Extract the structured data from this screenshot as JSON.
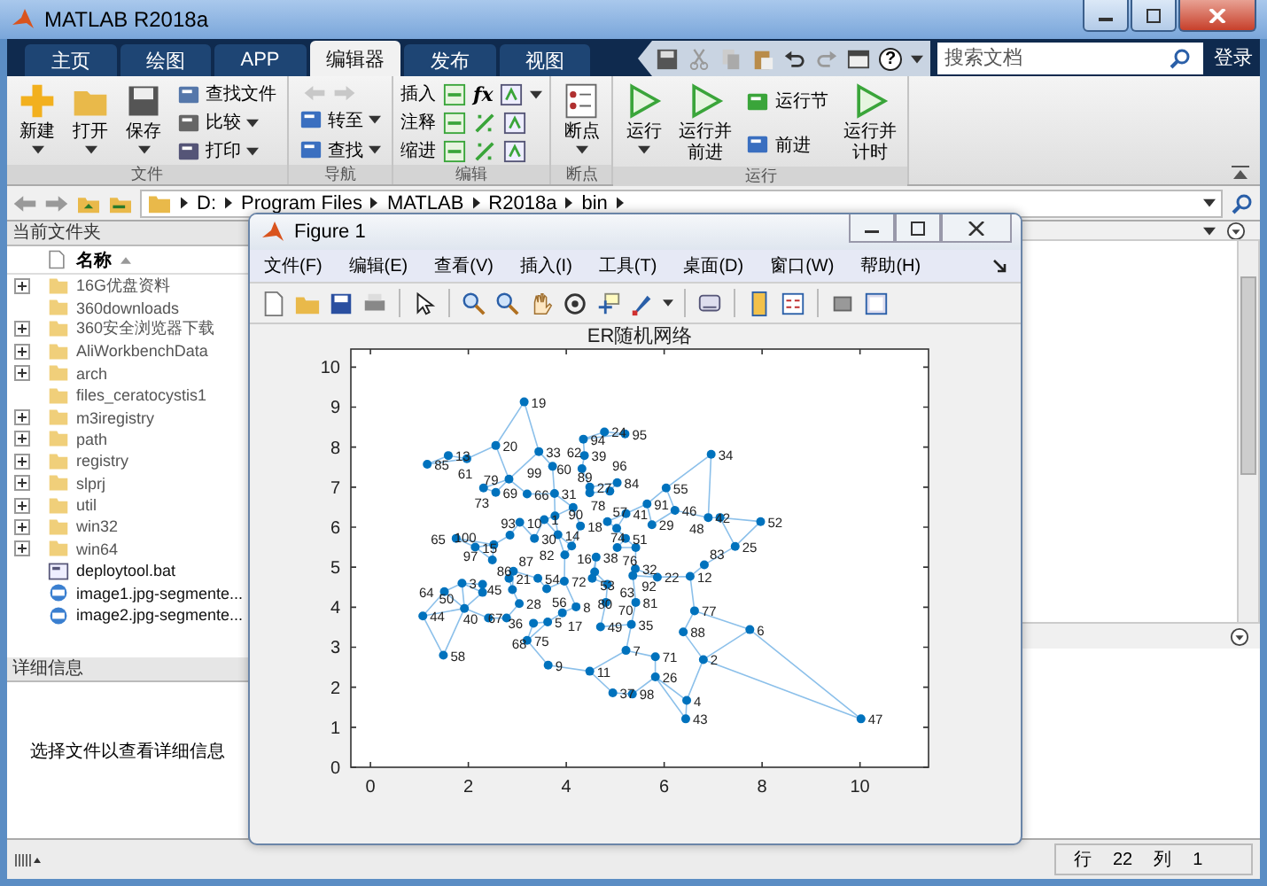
{
  "window": {
    "title": "MATLAB R2018a"
  },
  "tabs": [
    {
      "label": "主页",
      "selected": false
    },
    {
      "label": "绘图",
      "selected": false
    },
    {
      "label": "APP",
      "selected": false
    },
    {
      "label": "编辑器",
      "selected": true
    },
    {
      "label": "发布",
      "selected": false
    },
    {
      "label": "视图",
      "selected": false
    }
  ],
  "quick_access": {
    "help_symbol": "?"
  },
  "search": {
    "placeholder": "搜索文档"
  },
  "login_button": "登录",
  "ribbon": [
    {
      "label": "文件",
      "buttons": [
        {
          "kind": "large",
          "label": "新建",
          "dropdown": true
        },
        {
          "kind": "large",
          "label": "打开",
          "dropdown": true
        },
        {
          "kind": "large",
          "label": "保存",
          "dropdown": true
        },
        {
          "kind": "small",
          "label": "查找文件",
          "dropdown": false
        },
        {
          "kind": "small",
          "label": "比较",
          "dropdown": true
        },
        {
          "kind": "small",
          "label": "打印",
          "dropdown": true
        }
      ]
    },
    {
      "label": "导航",
      "buttons": [
        {
          "kind": "arrows",
          "disabled": true
        },
        {
          "kind": "small",
          "label": "转至",
          "dropdown": true
        },
        {
          "kind": "small",
          "label": "查找",
          "dropdown": true
        }
      ]
    },
    {
      "label": "编辑",
      "buttons": [
        {
          "kind": "row",
          "label": "插入",
          "symbol": "fx",
          "dropdown": true
        },
        {
          "kind": "row",
          "label": "注释",
          "dropdown": false
        },
        {
          "kind": "row",
          "label": "缩进",
          "dropdown": false
        }
      ]
    },
    {
      "label": "断点",
      "buttons": [
        {
          "kind": "large",
          "label": "断点",
          "dropdown": true
        }
      ]
    },
    {
      "label": "运行",
      "buttons": [
        {
          "kind": "large",
          "label": "运行",
          "dropdown": true
        },
        {
          "kind": "large",
          "label": "运行并前进",
          "dropdown": false
        },
        {
          "kind": "small",
          "label": "运行节",
          "dropdown": false
        },
        {
          "kind": "small",
          "label": "前进",
          "dropdown": false
        },
        {
          "kind": "large",
          "label": "运行并计时",
          "dropdown": false
        }
      ]
    }
  ],
  "address_bar": {
    "segments": [
      "D:",
      "Program Files",
      "MATLAB",
      "R2018a",
      "bin"
    ]
  },
  "current_folder": {
    "title": "当前文件夹",
    "column": "名称",
    "items": [
      {
        "kind": "folder",
        "name": "16G优盘资料",
        "expandable": true
      },
      {
        "kind": "folder",
        "name": "360downloads",
        "expandable": false
      },
      {
        "kind": "folder",
        "name": "360安全浏览器下载",
        "expandable": true
      },
      {
        "kind": "folder",
        "name": "AliWorkbenchData",
        "expandable": true
      },
      {
        "kind": "folder",
        "name": "arch",
        "expandable": true
      },
      {
        "kind": "folder",
        "name": "files_ceratocystis1",
        "expandable": false
      },
      {
        "kind": "folder",
        "name": "m3iregistry",
        "expandable": true
      },
      {
        "kind": "folder",
        "name": "path",
        "expandable": true
      },
      {
        "kind": "folder",
        "name": "registry",
        "expandable": true
      },
      {
        "kind": "folder",
        "name": "slprj",
        "expandable": true
      },
      {
        "kind": "folder",
        "name": "util",
        "expandable": true
      },
      {
        "kind": "folder",
        "name": "win32",
        "expandable": true
      },
      {
        "kind": "folder",
        "name": "win64",
        "expandable": true
      },
      {
        "kind": "script",
        "name": "deploytool.bat",
        "expandable": false
      },
      {
        "kind": "image",
        "name": "image1.jpg-segmente...",
        "expandable": false
      },
      {
        "kind": "image",
        "name": "image2.jpg-segmente...",
        "expandable": false
      }
    ]
  },
  "details": {
    "title": "详细信息",
    "message": "选择文件以查看详细信息"
  },
  "status_bar": {
    "row_label": "行",
    "row": "22",
    "col_label": "列",
    "col": "1"
  },
  "figure": {
    "title": "Figure 1",
    "menu": [
      "文件(F)",
      "编辑(E)",
      "查看(V)",
      "插入(I)",
      "工具(T)",
      "桌面(D)",
      "窗口(W)",
      "帮助(H)"
    ],
    "chart_data": {
      "type": "scatter",
      "title": "ER随机网络",
      "xlim": [
        -0.4,
        11.4
      ],
      "ylim": [
        0,
        10.45
      ],
      "xticks": [
        0,
        2,
        4,
        6,
        8,
        10
      ],
      "yticks": [
        0,
        1,
        2,
        3,
        4,
        5,
        6,
        7,
        8,
        9,
        10
      ],
      "x": [
        3.55,
        6.8,
        1.87,
        6.46,
        3.62,
        7.75,
        5.22,
        4.2,
        3.63,
        3.05,
        4.48,
        6.53,
        1.59,
        3.83,
        2.14,
        4.11,
        3.92,
        4.29,
        3.14,
        2.56,
        2.83,
        5.86,
        4.78,
        7.45,
        5.82,
        4.48,
        3.04,
        5.75,
        3.35,
        3.76,
        5.41,
        3.44,
        6.96,
        5.33,
        3.33,
        4.95,
        4.61,
        4.37,
        2.41,
        5.22,
        6.9,
        6.44,
        1.07,
        2.9,
        6.22,
        10.02,
        7.14,
        4.7,
        1.92,
        5.21,
        7.97,
        4.58,
        3.42,
        6.04,
        3.6,
        4.84,
        1.49,
        4.32,
        1.97,
        3.72,
        4.84,
        1.51,
        1.75,
        3.2,
        2.29,
        2.78,
        2.56,
        4.81,
        5.82,
        3.96,
        2.31,
        5.42,
        3.2,
        5.04,
        6.62,
        4.48,
        2.83,
        4.53,
        5.42,
        3.97,
        6.82,
        5.04,
        1.16,
        2.29,
        2.92,
        6.39,
        4.14,
        5.03,
        5.65,
        5.36,
        2.85,
        4.35,
        5.2,
        4.89,
        2.52,
        5.35,
        3.77,
        2.49
      ],
      "series": [
        {
          "color": "#0072bd",
          "values": [
            6.19,
            2.69,
            4.6,
            1.67,
            3.63,
            3.44,
            2.92,
            4.01,
            2.55,
            6.12,
            2.4,
            4.77,
            7.79,
            5.81,
            5.5,
            5.53,
            3.86,
            6.03,
            9.13,
            8.04,
            4.72,
            4.75,
            8.38,
            5.52,
            2.26,
            7.0,
            4.09,
            6.06,
            5.72,
            6.84,
            4.96,
            7.89,
            7.82,
            3.57,
            3.6,
            1.86,
            5.25,
            7.79,
            3.73,
            6.34,
            6.24,
            1.21,
            3.78,
            4.44,
            6.42,
            1.21,
            6.24,
            3.51,
            3.97,
            5.72,
            6.14,
            4.88,
            4.72,
            6.98,
            4.46,
            6.14,
            2.8,
            7.46,
            7.71,
            7.52,
            4.57,
            4.39,
            5.72,
            6.83,
            4.37,
            3.73,
            6.87,
            4.12,
            2.76,
            4.65,
            6.98,
            5.49,
            3.17,
            5.49,
            3.91,
            6.86,
            7.2,
            4.72,
            4.12,
            5.31,
            5.06,
            7.11,
            7.57,
            4.57,
            4.9,
            3.38,
            6.49,
            5.97,
            6.58,
            4.79,
            5.8,
            8.2,
            8.33,
            6.9,
            5.56,
            1.83,
            6.28,
            5.18
          ]
        }
      ],
      "value_labels": [
        "1",
        "2",
        "3",
        "4",
        "5",
        "6",
        "7",
        "8",
        "9",
        "10",
        "11",
        "12",
        "13",
        "14",
        "15",
        "16",
        "17",
        "18",
        "19",
        "20",
        "21",
        "22",
        "24",
        "25",
        "26",
        "27",
        "28",
        "29",
        "30",
        "31",
        "32",
        "33",
        "34",
        "35",
        "36",
        "37",
        "38",
        "39",
        "40",
        "41",
        "42",
        "43",
        "44",
        "45",
        "46",
        "47",
        "48",
        "49",
        "50",
        "51",
        "52",
        "53",
        "54",
        "55",
        "56",
        "57",
        "58",
        "60",
        "61",
        "62",
        "63",
        "64",
        "65",
        "66",
        "67",
        "68",
        "69",
        "70",
        "71",
        "72",
        "73",
        "74",
        "75",
        "76",
        "77",
        "78",
        "79",
        "80",
        "81",
        "82",
        "83",
        "84",
        "85",
        "86",
        "87",
        "88",
        "89",
        "90",
        "91",
        "92",
        "93",
        "94",
        "95",
        "96",
        "97",
        "98",
        "99",
        "100"
      ]
    }
  }
}
